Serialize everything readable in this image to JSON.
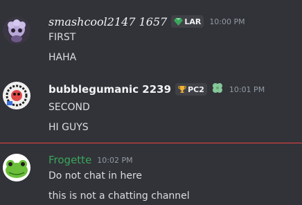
{
  "messages": [
    {
      "username": "smashcool2147 1657",
      "tag": "LAR",
      "tag_icon": "gem-icon",
      "time": "10:00 PM",
      "lines": [
        "FIRST",
        "HAHA"
      ]
    },
    {
      "username": "bubblegumanic 2239",
      "tag": "PC2",
      "tag_icon": "trophy-icon",
      "extra_icon": "clover-icon",
      "time": "10:01 PM",
      "lines": [
        "SECOND",
        "HI GUYS"
      ]
    },
    {
      "username": "Frogette",
      "time": "10:02 PM",
      "lines": [
        "Do not chat in here",
        "this is not a chatting channel"
      ]
    }
  ],
  "colors": {
    "background": "#313338",
    "new_messages_divider": "#f23f43",
    "frogette_name": "#3ba55c"
  }
}
